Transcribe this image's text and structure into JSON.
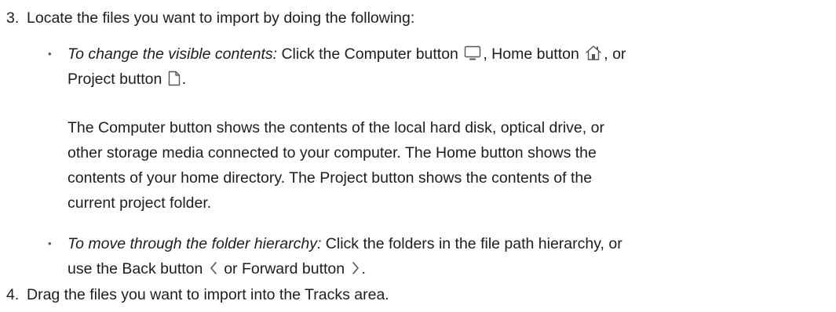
{
  "steps": [
    {
      "number": "3.",
      "text": "Locate the files you want to import by doing the following:"
    },
    {
      "number": "4.",
      "text": "Drag the files you want to import into the Tracks area."
    }
  ],
  "bullets": [
    {
      "marker": "•",
      "lead": "To change the visible contents:",
      "part1": " Click the Computer button ",
      "icon1": "computer-icon",
      "part2": ", Home button ",
      "icon2": "home-icon",
      "part3": ", or",
      "line2": "Project button ",
      "icon3": "document-icon",
      "part4": "."
    },
    {
      "marker": "•",
      "lead": "To move through the folder hierarchy:",
      "part1": " Click the folders in the file path hierarchy, or",
      "line2": "use the Back button ",
      "icon1": "back-chevron-icon",
      "part2": " or Forward button ",
      "icon2": "forward-chevron-icon",
      "part3": "."
    }
  ],
  "explanation": {
    "line1": "The Computer button shows the contents of the local hard disk, optical drive, or",
    "line2": "other storage media connected to your computer. The Home button shows the",
    "line3": "contents of your home directory. The Project button shows the contents of the",
    "line4": "current project folder."
  },
  "colors": {
    "text": "#1d1d1f",
    "icon": "#555555"
  }
}
